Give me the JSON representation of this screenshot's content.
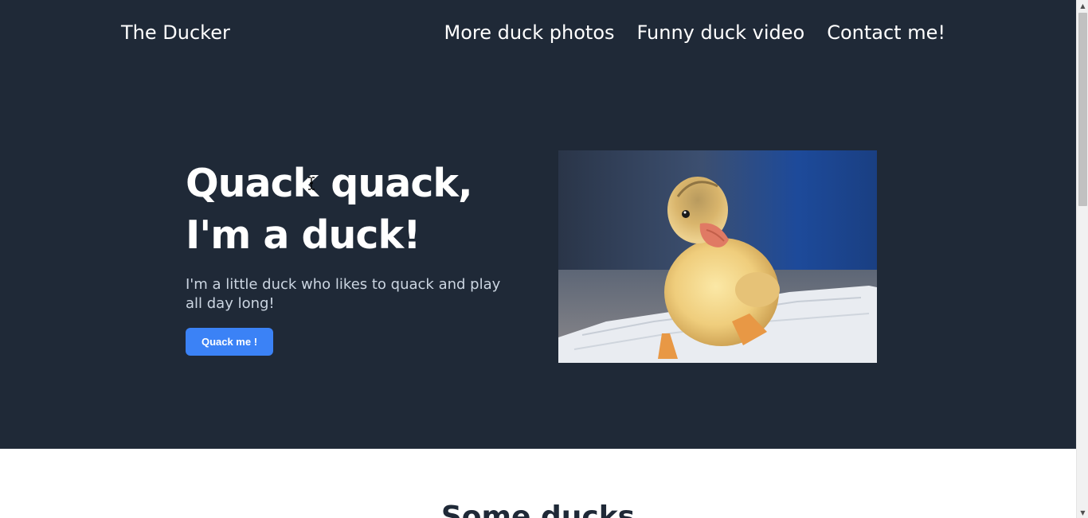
{
  "header": {
    "brand": "The Ducker",
    "nav": [
      "More duck photos",
      "Funny duck video",
      "Contact me!"
    ]
  },
  "hero": {
    "title": "Quack quack, I'm a duck!",
    "subtitle": "I'm a little duck who likes to quack and play all day long!",
    "cta_label": "Quack me !",
    "image_alt": "duckling-photo"
  },
  "section": {
    "title": "Some ducks"
  },
  "colors": {
    "hero_bg": "#1f2937",
    "accent": "#3b82f6",
    "text_light": "#ffffff",
    "text_muted": "#cbd5e1",
    "page_bg": "#ffffff",
    "heading_dark": "#1f2937"
  }
}
